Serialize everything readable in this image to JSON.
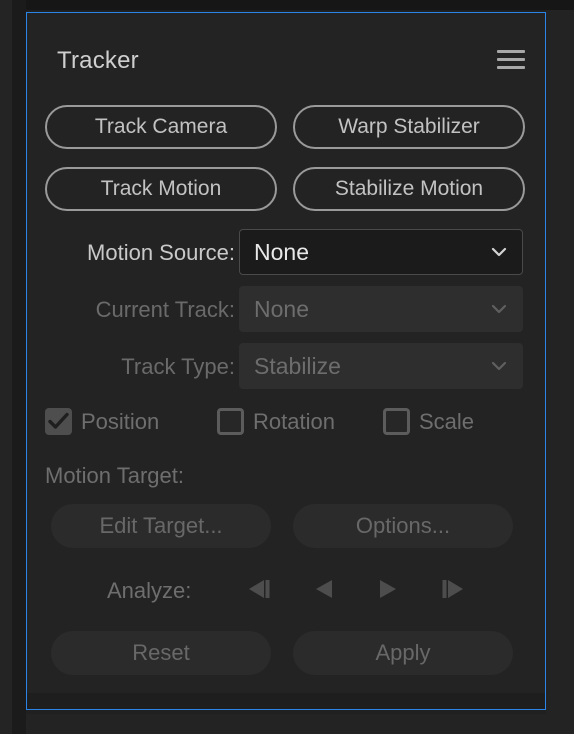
{
  "panel": {
    "title": "Tracker",
    "menu_icon": "hamburger-menu-icon",
    "accent_color": "#2b85e8",
    "background_color": "#232323"
  },
  "actions": {
    "track_camera": "Track Camera",
    "warp_stabilizer": "Warp Stabilizer",
    "track_motion": "Track Motion",
    "stabilize_motion": "Stabilize Motion"
  },
  "fields": {
    "motion_source": {
      "label": "Motion Source:",
      "value": "None",
      "enabled": true,
      "chevron_icon": "chevron-down-icon"
    },
    "current_track": {
      "label": "Current Track:",
      "value": "None",
      "enabled": false,
      "chevron_icon": "chevron-down-icon"
    },
    "track_type": {
      "label": "Track Type:",
      "value": "Stabilize",
      "enabled": false,
      "chevron_icon": "chevron-down-icon"
    }
  },
  "checkboxes": [
    {
      "label": "Position",
      "checked": true,
      "icon": "checkmark-icon"
    },
    {
      "label": "Rotation",
      "checked": false,
      "icon": "empty-checkbox-icon"
    },
    {
      "label": "Scale",
      "checked": false,
      "icon": "empty-checkbox-icon"
    }
  ],
  "motion_target": {
    "label": "Motion Target:",
    "edit_target": "Edit Target...",
    "options": "Options..."
  },
  "analyze": {
    "label": "Analyze:",
    "buttons": [
      {
        "name": "analyze-1-frame-backward",
        "icon": "step-backward-icon"
      },
      {
        "name": "analyze-backward",
        "icon": "play-backward-icon"
      },
      {
        "name": "analyze-forward",
        "icon": "play-forward-icon"
      },
      {
        "name": "analyze-1-frame-forward",
        "icon": "step-forward-icon"
      }
    ]
  },
  "footer": {
    "reset": "Reset",
    "apply": "Apply"
  }
}
